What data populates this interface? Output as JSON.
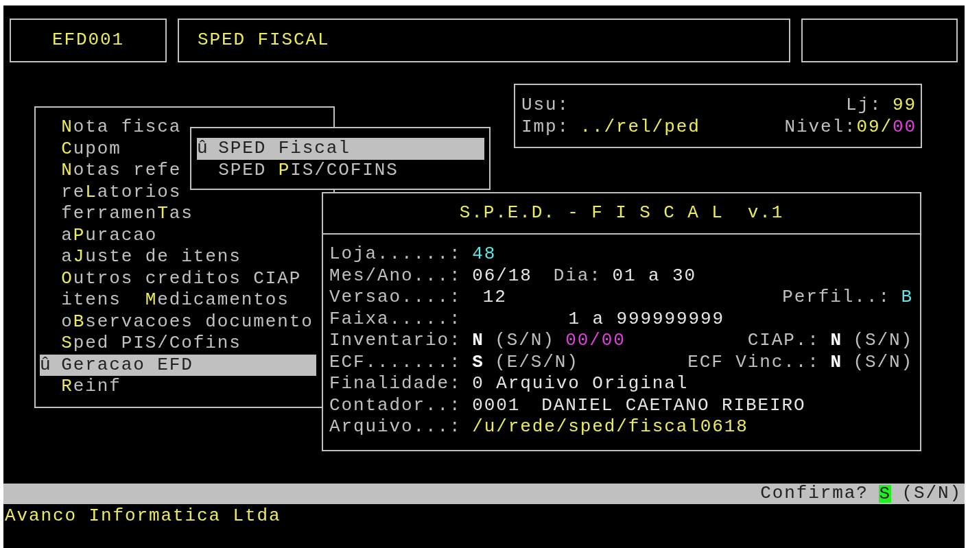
{
  "header": {
    "code": "EFD001",
    "title": "SPED FISCAL"
  },
  "session": {
    "rows": [
      {
        "left": [
          {
            "text": "Usu:",
            "kind": "label"
          }
        ],
        "right": [
          {
            "text": "Lj:",
            "kind": "label"
          },
          {
            "text": "99",
            "kind": "yellow"
          }
        ]
      },
      {
        "left": [
          {
            "text": "Imp:",
            "kind": "label"
          },
          {
            "text": "../rel/ped",
            "kind": "yellow"
          }
        ],
        "right": [
          {
            "text": "Nivel:",
            "kind": "label"
          },
          {
            "text": "09/",
            "kind": "yellow",
            "join": true
          },
          {
            "text": "00",
            "kind": "magenta"
          }
        ]
      }
    ]
  },
  "menu": {
    "items": [
      {
        "key": "N",
        "after": "ota fisca",
        "selected": false
      },
      {
        "key": "C",
        "after": "upom",
        "selected": false
      },
      {
        "key": "N",
        "after": "otas refe",
        "selected": false
      },
      {
        "before": "re",
        "key": "L",
        "after": "atorios",
        "selected": false
      },
      {
        "before": "ferramen",
        "key": "T",
        "after": "as",
        "selected": false
      },
      {
        "before": "a",
        "key": "P",
        "after": "uracao",
        "selected": false
      },
      {
        "before": "a",
        "key": "J",
        "after": "uste de itens",
        "selected": false
      },
      {
        "key": "O",
        "after": "utros creditos CIAP",
        "selected": false
      },
      {
        "before": "itens  ",
        "key": "M",
        "after": "edicamentos",
        "selected": false
      },
      {
        "before": "o",
        "key": "B",
        "after": "servacoes documento",
        "selected": false
      },
      {
        "key": "S",
        "after": "ped PIS/Cofins",
        "selected": false
      },
      {
        "marker": "û",
        "before": "Geracao EFD",
        "selected": true
      },
      {
        "key": "R",
        "after": "einf",
        "selected": false
      }
    ]
  },
  "submenu": {
    "items": [
      {
        "marker": "û",
        "before": "SPED Fiscal",
        "selected": true
      },
      {
        "before": "SPED ",
        "key": "P",
        "after": "IS/COFINS",
        "selected": false
      }
    ]
  },
  "dialog": {
    "title": "S.P.E.D. - F I S C A L  v.1",
    "rows": [
      {
        "left": [
          {
            "text": "Loja......:",
            "kind": "label"
          },
          {
            "text": "48",
            "kind": "cyan"
          }
        ]
      },
      {
        "left": [
          {
            "text": "Mes/Ano...:",
            "kind": "label"
          },
          {
            "text": "06/18",
            "kind": "text"
          },
          {
            "text": "Dia:",
            "kind": "label",
            "wide": true
          },
          {
            "text": "01 a 30",
            "kind": "text"
          }
        ]
      },
      {
        "left": [
          {
            "text": "Versao....:",
            "kind": "label"
          },
          {
            "text": "12",
            "kind": "text",
            "wide": true
          }
        ],
        "right": [
          {
            "text": "Perfil..:",
            "kind": "label"
          },
          {
            "text": "B",
            "kind": "cyan"
          }
        ]
      },
      {
        "left": [
          {
            "text": "Faixa.....:",
            "kind": "label"
          },
          {
            "text": "1 a 999999999",
            "kind": "text",
            "far": true
          }
        ]
      },
      {
        "left": [
          {
            "text": "Inventario:",
            "kind": "label"
          },
          {
            "text": "N",
            "kind": "bold"
          },
          {
            "text": "(S/N)",
            "kind": "label"
          },
          {
            "text": "00/00",
            "kind": "magenta"
          }
        ],
        "right": [
          {
            "text": "CIAP.:",
            "kind": "label"
          },
          {
            "text": "N",
            "kind": "bold"
          },
          {
            "text": "(S/N)",
            "kind": "label"
          }
        ]
      },
      {
        "left": [
          {
            "text": "ECF.......:",
            "kind": "label"
          },
          {
            "text": "S",
            "kind": "bold"
          },
          {
            "text": "(E/S/N)",
            "kind": "label"
          }
        ],
        "right": [
          {
            "text": "ECF Vinc..:",
            "kind": "label"
          },
          {
            "text": "N",
            "kind": "bold"
          },
          {
            "text": "(S/N)",
            "kind": "label"
          }
        ]
      },
      {
        "left": [
          {
            "text": "Finalidade:",
            "kind": "label"
          },
          {
            "text": "0 Arquivo Original",
            "kind": "text"
          }
        ]
      },
      {
        "left": [
          {
            "text": "Contador..:",
            "kind": "label"
          },
          {
            "text": "0001",
            "kind": "text"
          },
          {
            "text": "DANIEL CAETANO RIBEIRO",
            "kind": "text",
            "wide": true
          }
        ]
      },
      {
        "left": [
          {
            "text": "Arquivo...:",
            "kind": "label"
          },
          {
            "text": "/u/rede/sped/fiscal0618",
            "kind": "yellow"
          }
        ]
      }
    ]
  },
  "status_bar": {
    "prompt": "Confirma?",
    "answer": "S",
    "options": "(S/N)"
  },
  "footer": "Avanco Informatica Ltda"
}
